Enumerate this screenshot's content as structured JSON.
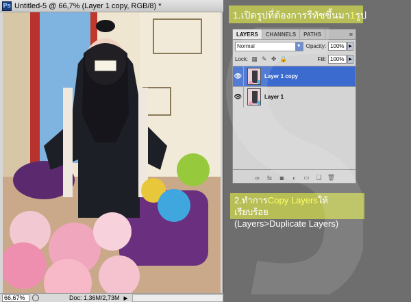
{
  "window": {
    "title": "Untitled-5 @ 66,7% (Layer 1 copy, RGB/8) *",
    "app_icon_letter": "Ps",
    "zoom": "66,67%",
    "doc_info": "Doc: 1,36M/2,73M"
  },
  "step1": {
    "prefix": "1.เปิดรูปที่ต้องการรีทัชขึ้นมา",
    "number": "1",
    "suffix": "รูป"
  },
  "layers_panel": {
    "tabs": [
      "LAYERS",
      "CHANNELS",
      "PATHS"
    ],
    "blend_mode": "Normal",
    "opacity_label": "Opacity:",
    "opacity_value": "100%",
    "lock_label": "Lock:",
    "fill_label": "Fill:",
    "fill_value": "100%",
    "layers": [
      {
        "name": "Layer 1 copy",
        "selected": true
      },
      {
        "name": "Layer 1",
        "selected": false
      }
    ]
  },
  "step2": {
    "prefix": "2.ทำการ",
    "highlight": "Copy Layers",
    "suffix": "ให้เรียบร้อย",
    "line2": "(Layers>Duplicate Layers)"
  },
  "colors": {
    "accent_box": "#b7be55",
    "highlight_text": "#ffff66",
    "selected_layer": "#3c6bd0"
  }
}
